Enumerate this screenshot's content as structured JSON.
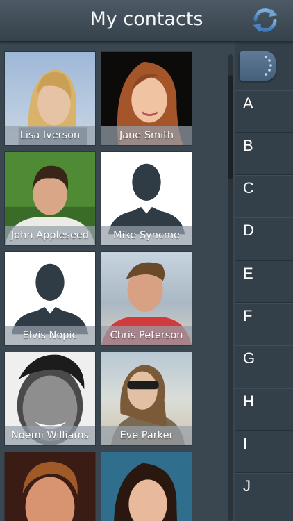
{
  "header": {
    "title": "My contacts",
    "sync_icon": "sync-icon"
  },
  "contacts": [
    {
      "name": "Lisa Iverson",
      "photo": "photo"
    },
    {
      "name": "Jane Smith",
      "photo": "photo"
    },
    {
      "name": "John Appleseed",
      "photo": "photo"
    },
    {
      "name": "Mike Syncme",
      "photo": "placeholder-avatar"
    },
    {
      "name": "Elvis Nopic",
      "photo": "placeholder-avatar"
    },
    {
      "name": "Chris Peterson",
      "photo": "photo"
    },
    {
      "name": "Noemi Williams",
      "photo": "photo"
    },
    {
      "name": "Eve Parker",
      "photo": "photo"
    },
    {
      "name": "",
      "photo": "photo"
    },
    {
      "name": "",
      "photo": "photo"
    }
  ],
  "index": {
    "letters": [
      "A",
      "B",
      "C",
      "D",
      "E",
      "F",
      "G",
      "H",
      "I",
      "J"
    ],
    "search_tab_icon": "dotted-arc-icon"
  },
  "colors": {
    "background": "#3a4650",
    "header": "#3f4c57",
    "caption": "#96a0aa",
    "accent": "#5f7a96"
  }
}
